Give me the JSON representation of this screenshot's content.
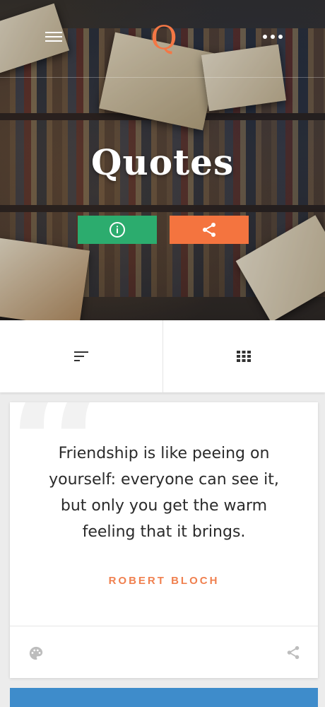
{
  "header": {
    "logo_letter": "Q",
    "title": "Quotes"
  },
  "hero_buttons": {
    "info_icon": "info-icon",
    "share_icon": "share-icon"
  },
  "tools": {
    "sort_icon": "sort-icon",
    "grid_icon": "grid-view-icon"
  },
  "quote_card": {
    "text": "Friendship is like peeing on yourself: everyone can see it, but only you get the warm feeling that it brings.",
    "author": "ROBERT BLOCH",
    "footer_left_icon": "palette-icon",
    "footer_right_icon": "share-icon"
  },
  "colors": {
    "accent_orange": "#f4743f",
    "info_green": "#2cac6e",
    "next_card_blue": "#3e8ccb"
  }
}
